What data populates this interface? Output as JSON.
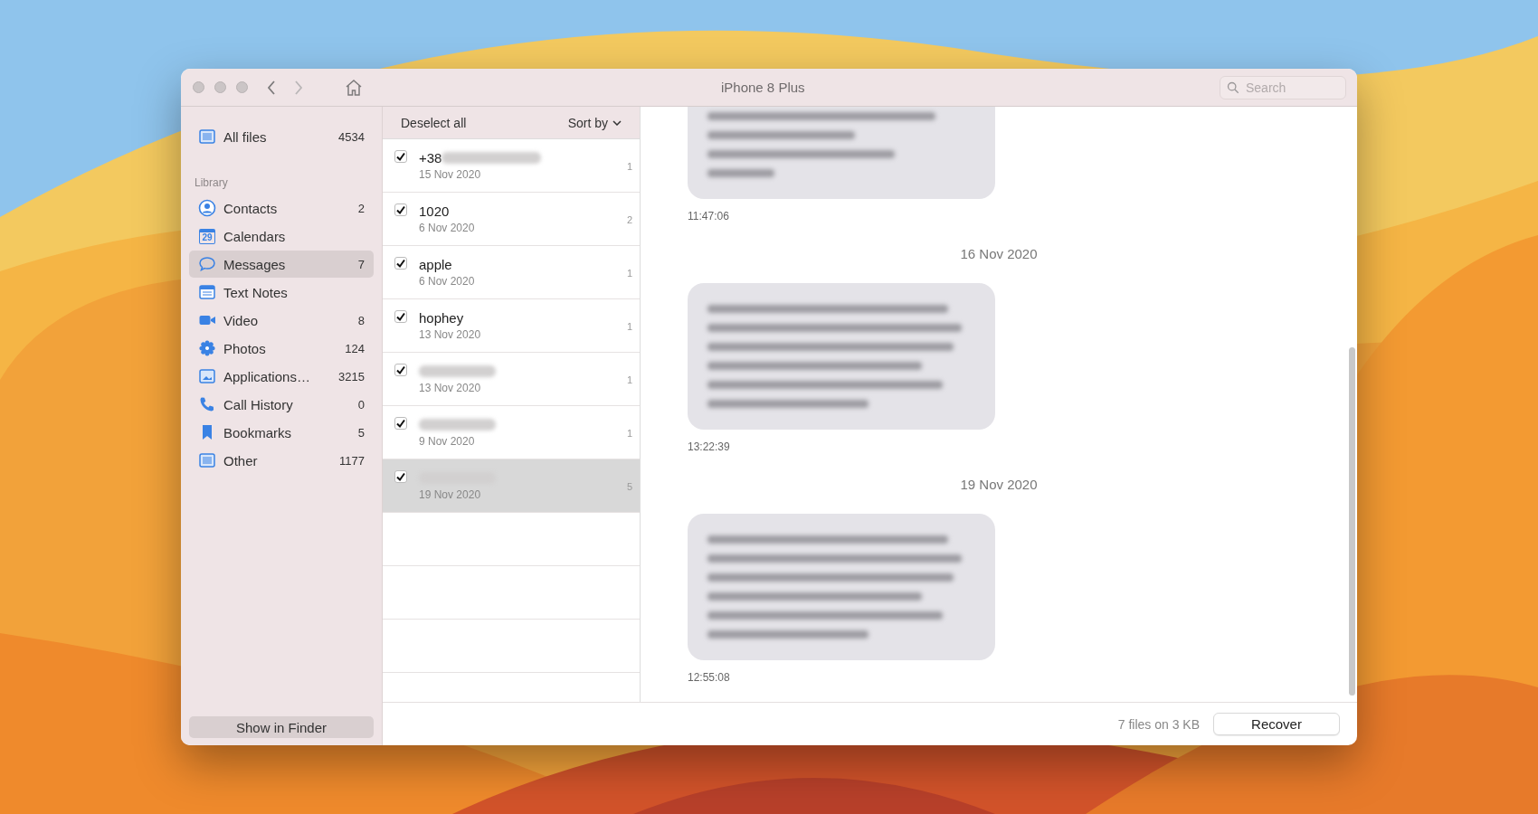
{
  "window": {
    "title": "iPhone 8 Plus",
    "search": {
      "placeholder": "Search"
    }
  },
  "sidebar": {
    "top_item": {
      "label": "All files",
      "count": "4534",
      "kind": "files",
      "selected": false
    },
    "section_title": "Library",
    "items": [
      {
        "label": "Contacts",
        "count": "2",
        "kind": "contacts",
        "selected": false
      },
      {
        "label": "Calendars",
        "kind": "calendar",
        "icon_label": "29",
        "selected": false
      },
      {
        "label": "Messages",
        "count": "7",
        "kind": "messages",
        "selected": true
      },
      {
        "label": "Text Notes",
        "kind": "notes",
        "selected": false
      },
      {
        "label": "Video",
        "count": "8",
        "kind": "video",
        "selected": false
      },
      {
        "label": "Photos",
        "count": "124",
        "kind": "photos",
        "selected": false
      },
      {
        "label": "Applications…",
        "count": "3215",
        "kind": "apps",
        "selected": false
      },
      {
        "label": "Call History",
        "count": "0",
        "kind": "phone",
        "selected": false
      },
      {
        "label": "Bookmarks",
        "count": "5",
        "kind": "bookmark",
        "selected": false
      },
      {
        "label": "Other",
        "count": "1177",
        "kind": "files",
        "selected": false
      }
    ],
    "button": "Show in Finder"
  },
  "list": {
    "deselect": "Deselect all",
    "sort": "Sort by",
    "conversations": [
      {
        "name": "+38",
        "name_blurred": true,
        "date": "15 Nov 2020",
        "count": "1",
        "checked": true,
        "selected": false
      },
      {
        "name": "1020",
        "date": "6 Nov 2020",
        "count": "2",
        "checked": true,
        "selected": false
      },
      {
        "name": "apple",
        "date": "6 Nov 2020",
        "count": "1",
        "checked": true,
        "selected": false
      },
      {
        "name": "hophey",
        "date": "13 Nov 2020",
        "count": "1",
        "checked": true,
        "selected": false
      },
      {
        "name_blurred": true,
        "date": "13 Nov 2020",
        "count": "1",
        "checked": true,
        "selected": false
      },
      {
        "name_blurred": true,
        "date": "9 Nov 2020",
        "count": "1",
        "checked": true,
        "selected": false
      },
      {
        "name_blurred": true,
        "date": "19 Nov 2020",
        "count": "5",
        "checked": true,
        "selected": true
      }
    ]
  },
  "thread": [
    {
      "kind": "message",
      "cut_off": true,
      "time": "11:47:06"
    },
    {
      "kind": "date",
      "text": "16 Nov 2020"
    },
    {
      "kind": "message",
      "cut_off": false,
      "time": "13:22:39"
    },
    {
      "kind": "date",
      "text": "19 Nov 2020"
    },
    {
      "kind": "message",
      "cut_off": false,
      "time": "12:55:08"
    }
  ],
  "status_bar": {
    "summary": "7 files on 3 KB",
    "button": "Recover"
  }
}
